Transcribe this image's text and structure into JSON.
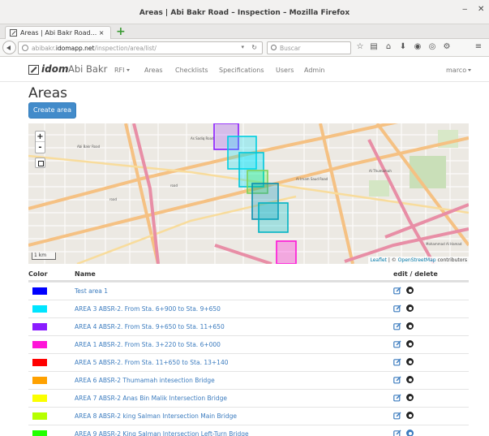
{
  "window": {
    "title": "Areas | Abi Bakr Road – Inspection – Mozilla Firefox"
  },
  "tab": {
    "label": "Areas | Abi Bakr Road... ×"
  },
  "navbar": {
    "url_prefix": "abibakr.",
    "url_domain": "idomapp.net",
    "url_path": "/inspection/area/list/",
    "search_placeholder": "Buscar"
  },
  "app": {
    "logo": "idom",
    "brand": "Abi Bakr",
    "menu": [
      "RFI",
      "Areas",
      "Checklists",
      "Specifications",
      "Users",
      "Admin"
    ],
    "user": "marco"
  },
  "page": {
    "title": "Areas",
    "create_button": "Create area"
  },
  "map": {
    "zoom_in": "+",
    "zoom_out": "-",
    "scale": "1 km",
    "attribution_leaflet": "Leaflet",
    "attribution_sep": " | © ",
    "attribution_osm": "OpenStreetMap",
    "attribution_tail": " contributors"
  },
  "table": {
    "headers": {
      "color": "Color",
      "name": "Name",
      "actions": "edit / delete"
    },
    "rows": [
      {
        "name": "Test area 1",
        "color": "#0000ff"
      },
      {
        "name": "AREA 3 ABSR-2. From Sta. 6+900 to Sta. 9+650",
        "color": "#00e5ff"
      },
      {
        "name": "AREA 4 ABSR-2. From Sta. 9+650 to Sta. 11+650",
        "color": "#8a1cff"
      },
      {
        "name": "AREA 1 ABSR-2. From Sta. 3+220 to Sta. 6+000",
        "color": "#ff14d8"
      },
      {
        "name": "AREA 5 ABSR-2. From Sta. 11+650 to Sta. 13+140",
        "color": "#ff0000"
      },
      {
        "name": "AREA 6 ABSR-2 Thumamah intesection Bridge",
        "color": "#ffa100"
      },
      {
        "name": "AREA 7 ABSR-2 Anas Bin Malik Intersection Bridge",
        "color": "#fbff00"
      },
      {
        "name": "AREA 8 ABSR-2 king Salman Intersection Main Bridge",
        "color": "#b6ff00"
      },
      {
        "name": "AREA 9 ABSR-2 King Salman Intersection Left-Turn Bridge",
        "color": "#22ff00"
      }
    ]
  },
  "icons": {
    "edit": "edit-icon",
    "delete": "delete-icon",
    "edit_color": "#3c7cbf"
  }
}
